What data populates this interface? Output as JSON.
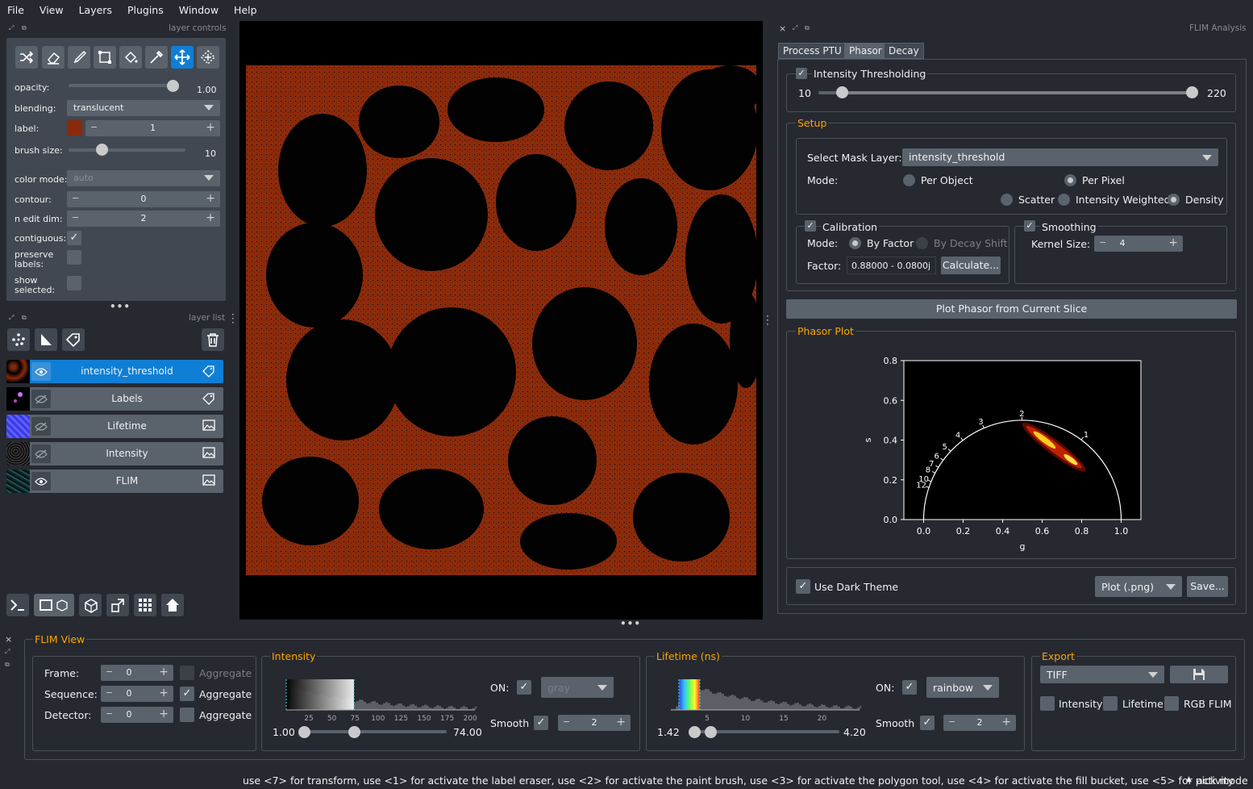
{
  "menu": [
    "File",
    "View",
    "Layers",
    "Plugins",
    "Window",
    "Help"
  ],
  "layer_controls": {
    "title": "layer controls",
    "opacity_label": "opacity:",
    "opacity_value": "1.00",
    "opacity_fraction": 1.0,
    "blending_label": "blending:",
    "blending_value": "translucent",
    "label_label": "label:",
    "label_value": "1",
    "label_color": "#8a2a0a",
    "brush_label": "brush size:",
    "brush_value": "10",
    "brush_fraction": 0.26,
    "colormode_label": "color mode:",
    "colormode_value": "auto",
    "contour_label": "contour:",
    "contour_value": "0",
    "nedit_label": "n edit dim:",
    "nedit_value": "2",
    "contiguous_label": "contiguous:",
    "preserve_label": "preserve\nlabels:",
    "show_label": "show\nselected:"
  },
  "layer_list": {
    "title": "layer list",
    "layers": [
      {
        "name": "intensity_threshold",
        "type": "labels"
      },
      {
        "name": "Labels",
        "type": "labels"
      },
      {
        "name": "Lifetime",
        "type": "image"
      },
      {
        "name": "Intensity",
        "type": "image"
      },
      {
        "name": "FLIM",
        "type": "image"
      }
    ]
  },
  "flim": {
    "title": "FLIM Analysis",
    "tabs": [
      "Process PTU",
      "Phasor",
      "Decay"
    ],
    "thresh_label": "Intensity Thresholding",
    "thresh_min": "10",
    "thresh_max": "220",
    "setup_title": "Setup",
    "mask_label": "Select Mask Layer:",
    "mask_value": "intensity_threshold",
    "mode_label": "Mode:",
    "per_object": "Per Object",
    "per_pixel": "Per Pixel",
    "scatter": "Scatter",
    "intensity_weighted": "Intensity Weighted",
    "density": "Density",
    "calibration": "Calibration",
    "cal_mode": "Mode:",
    "by_factor": "By Factor",
    "by_decay": "By Decay Shift",
    "factor_label": "Factor:",
    "factor_value": "0.88000 - 0.0800j",
    "calculate": "Calculate...",
    "smoothing": "Smoothing",
    "kernel_label": "Kernel Size:",
    "kernel_value": "4",
    "plot_button": "Plot Phasor from Current Slice",
    "phasor_title": "Phasor Plot",
    "dark_theme": "Use Dark Theme",
    "plot_format": "Plot (.png)",
    "save": "Save..."
  },
  "chart_data": {
    "type": "scatter",
    "xlabel": "g",
    "ylabel": "s",
    "xlim": [
      -0.1,
      1.1
    ],
    "ylim": [
      0.0,
      0.8
    ],
    "xticks": [
      "0.0",
      "0.2",
      "0.4",
      "0.6",
      "0.8",
      "1.0"
    ],
    "yticks": [
      "0.0",
      "0.2",
      "0.4",
      "0.6",
      "0.8"
    ],
    "semicircle_labels": [
      "1",
      "2",
      "3",
      "4",
      "5",
      "6",
      "7",
      "8",
      "10",
      "12"
    ],
    "cluster": {
      "g_start": 0.52,
      "s_start": 0.47,
      "g_end": 0.8,
      "s_end": 0.26
    }
  },
  "flim_view": {
    "title": "FLIM View",
    "frame_label": "Frame:",
    "frame_value": "0",
    "sequence_label": "Sequence:",
    "sequence_value": "0",
    "detector_label": "Detector:",
    "detector_value": "0",
    "aggregate": "Aggregate",
    "intensity_title": "Intensity",
    "intensity_ticks": [
      "25",
      "50",
      "75",
      "100",
      "125",
      "150",
      "175",
      "200"
    ],
    "intensity_min": "1.00",
    "intensity_max": "74.00",
    "on_label": "ON:",
    "gray": "gray",
    "smooth_label": "Smooth",
    "smooth_value": "2",
    "lifetime_title": "Lifetime (ns)",
    "lifetime_ticks": [
      "5",
      "10",
      "15",
      "20"
    ],
    "lifetime_min": "1.42",
    "lifetime_max": "4.20",
    "rainbow": "rainbow",
    "export_title": "Export",
    "export_format": "TIFF",
    "exp_intensity": "Intensity",
    "exp_lifetime": "Lifetime",
    "exp_rgb": "RGB FLIM"
  },
  "status": {
    "message": "use <7> for transform, use <1> for activate the label eraser, use <2> for activate the paint brush, use <3> for activate the polygon tool, use <4> for activate the fill bucket, use <5> for pick mode",
    "activity": "activity"
  }
}
